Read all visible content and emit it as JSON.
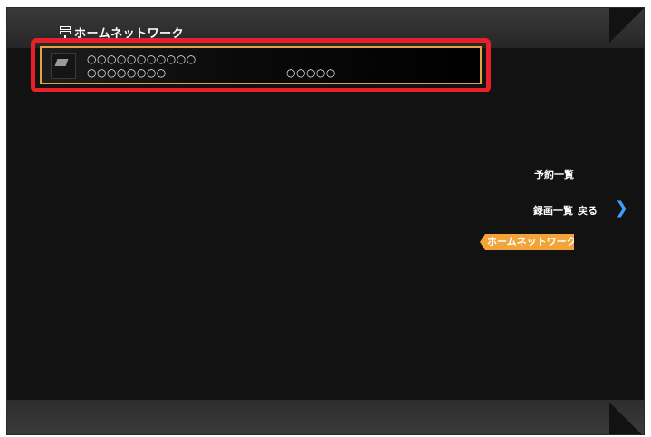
{
  "header": {
    "title": "ホームネットワーク",
    "icon": "network-icon"
  },
  "device_list": {
    "items": [
      {
        "name": "○○○○○○○○○○○",
        "subtitle": "○○○○○○○○",
        "extra": "○○○○○",
        "icon": "server-icon"
      }
    ]
  },
  "side_menu": {
    "reserve_label": "予約一覧",
    "record_label": "録画一覧",
    "back_label": "戻る",
    "back_icon": "chevron-right-icon",
    "active_label": "ホームネットワーク"
  },
  "colors": {
    "highlight_red": "#e8202a",
    "selection_orange": "#e2a440",
    "active_menu": "#f2a43a",
    "chevron_blue": "#3aa0ff"
  }
}
